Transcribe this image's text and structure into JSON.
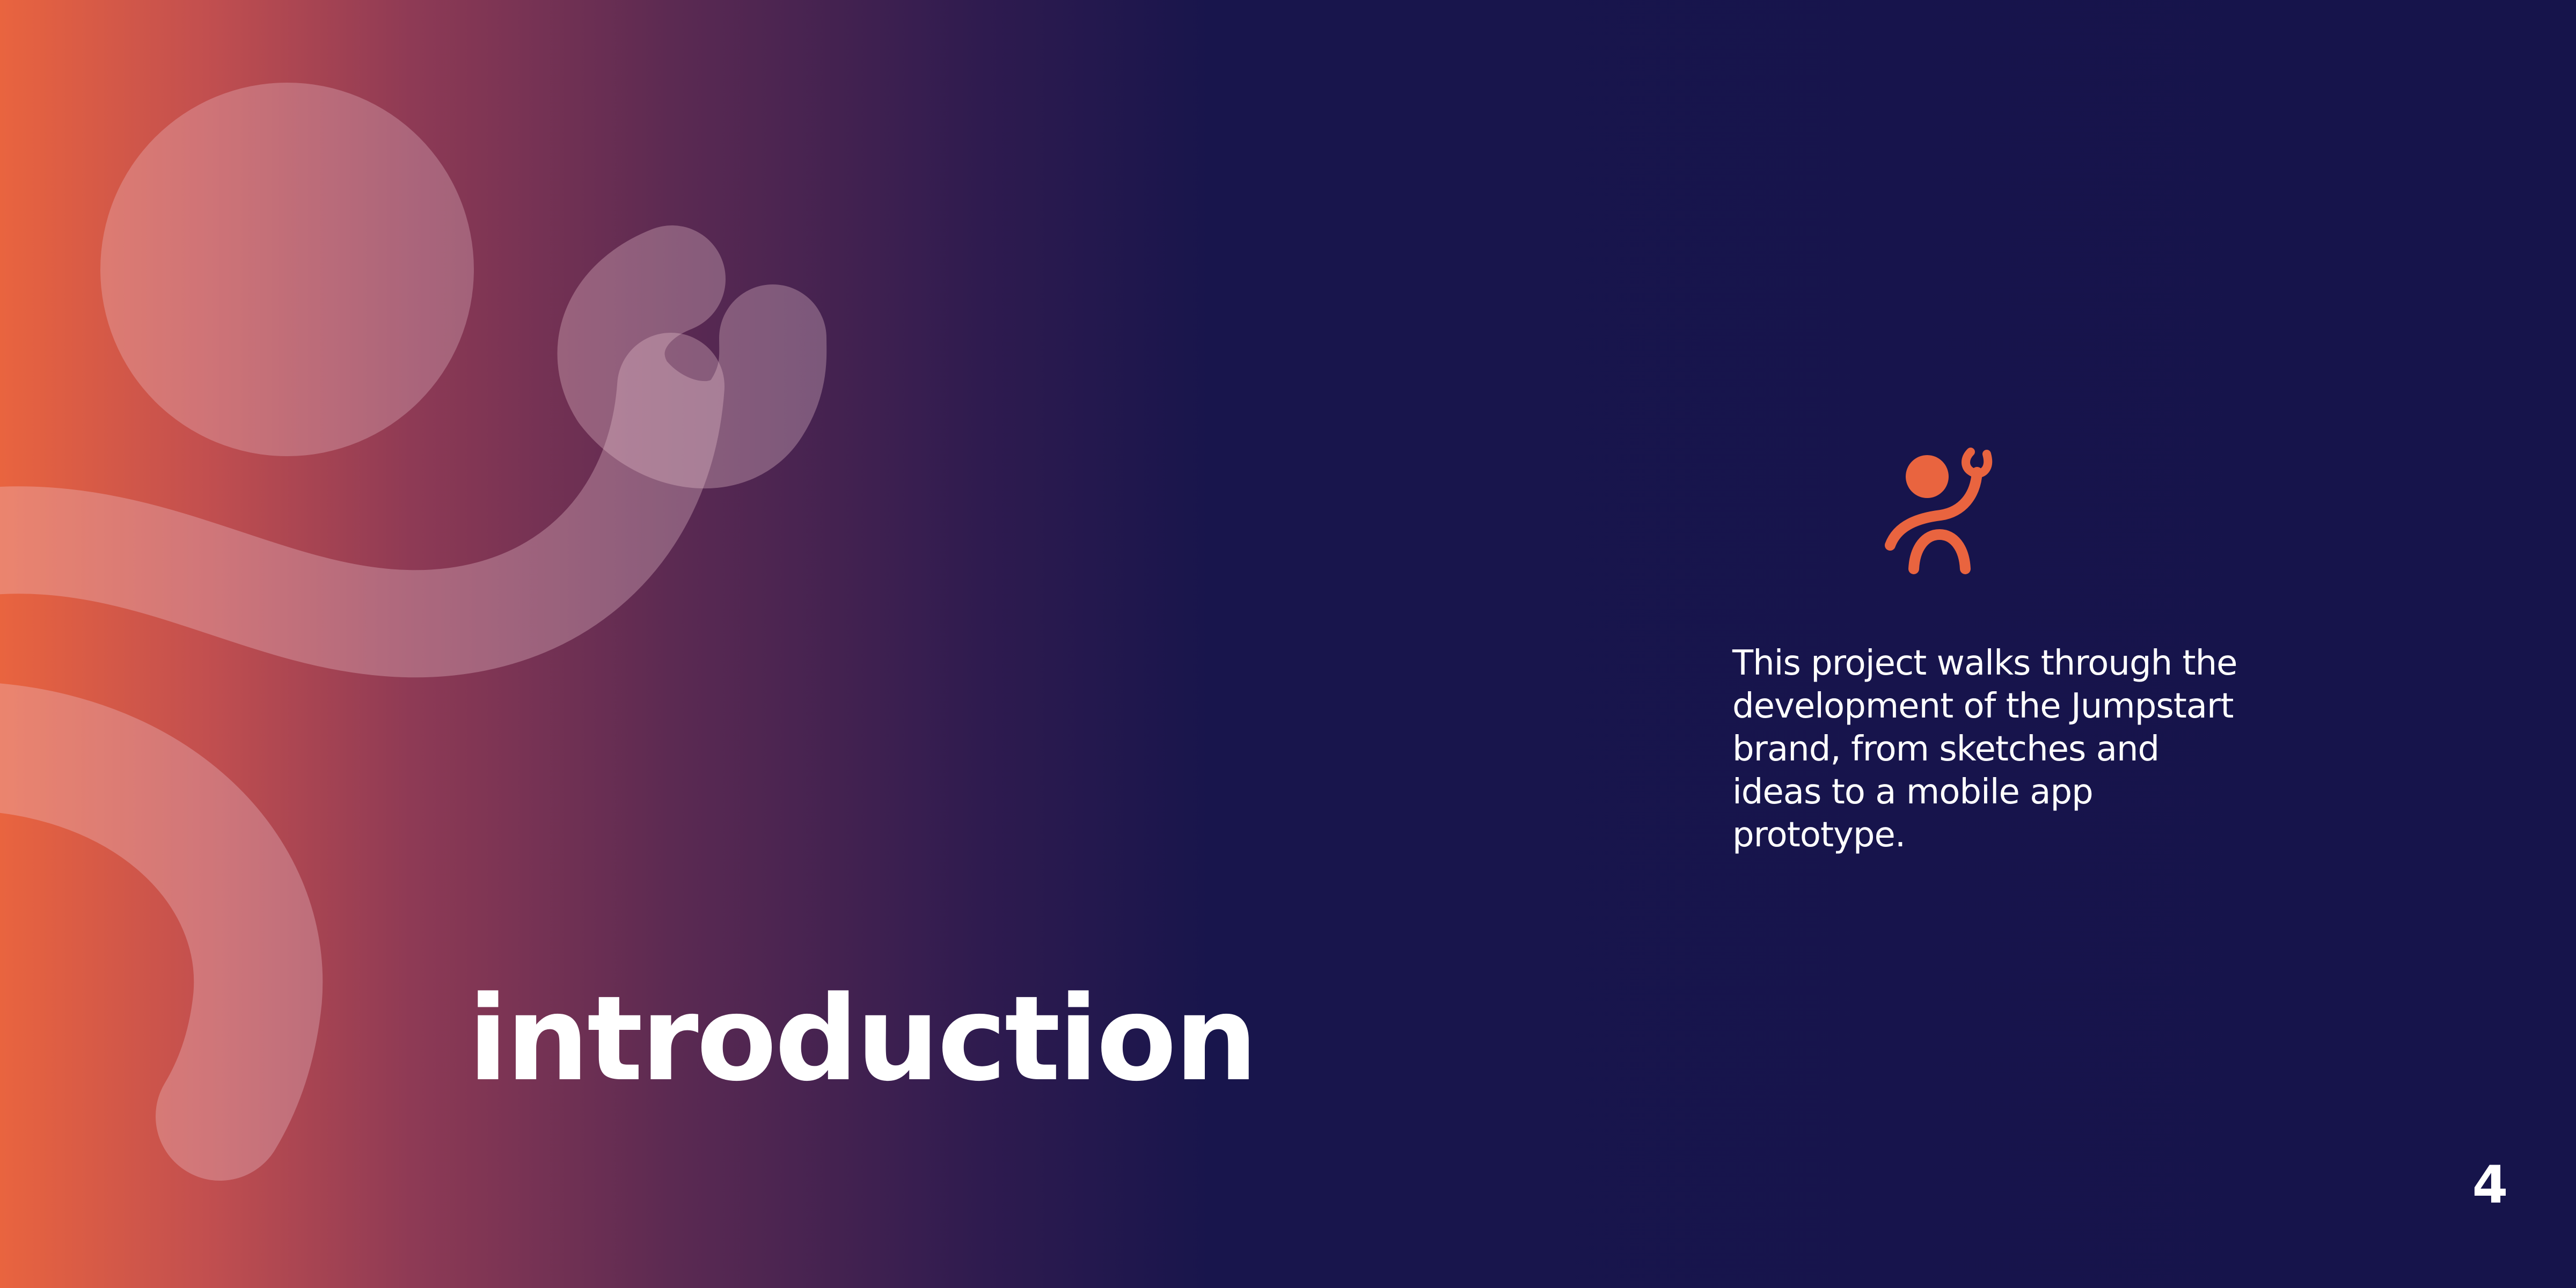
{
  "slide": {
    "title": "introduction",
    "body": "This project walks through the development of the Jumpstart brand, from sketches and ideas to a mobile app prototype.",
    "page_number": "4"
  },
  "colors": {
    "background": "#16144b",
    "accent": "#e9643f",
    "text": "#ffffff"
  },
  "icons": {
    "brand_mark": "jumpstart-figure-logo",
    "background_figure": "jumpstart-figure-watermark"
  }
}
